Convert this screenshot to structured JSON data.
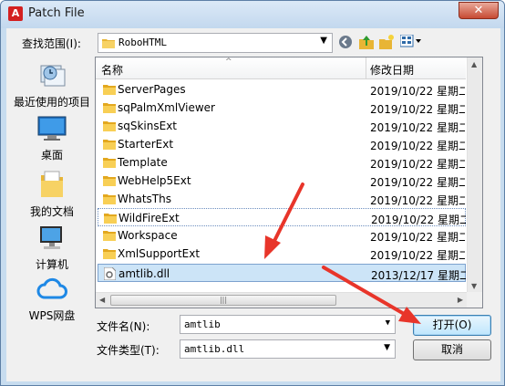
{
  "window": {
    "title": "Patch File",
    "app_icon_letter": "A",
    "close_symbol": "✕"
  },
  "lookin": {
    "label": "查找范围(I):",
    "value": "RoboHTML"
  },
  "toolbar": {
    "back_icon": "back-arrow-icon",
    "up_icon": "up-folder-icon",
    "newfolder_icon": "new-folder-icon",
    "views_icon": "views-menu-icon"
  },
  "places": [
    {
      "label": "最近使用的项目",
      "icon": "recent-items-icon"
    },
    {
      "label": "桌面",
      "icon": "desktop-icon"
    },
    {
      "label": "我的文档",
      "icon": "documents-icon"
    },
    {
      "label": "计算机",
      "icon": "computer-icon"
    },
    {
      "label": "WPS网盘",
      "icon": "cloud-icon"
    }
  ],
  "columns": {
    "name": "名称",
    "modified": "修改日期"
  },
  "files": [
    {
      "name": "ServerPages",
      "date": "2019/10/22 星期二 ...",
      "type": "folder"
    },
    {
      "name": "sqPalmXmlViewer",
      "date": "2019/10/22 星期二 ...",
      "type": "folder"
    },
    {
      "name": "sqSkinsExt",
      "date": "2019/10/22 星期二 ...",
      "type": "folder"
    },
    {
      "name": "StarterExt",
      "date": "2019/10/22 星期二 ...",
      "type": "folder"
    },
    {
      "name": "Template",
      "date": "2019/10/22 星期二 ...",
      "type": "folder"
    },
    {
      "name": "WebHelp5Ext",
      "date": "2019/10/22 星期二 ...",
      "type": "folder"
    },
    {
      "name": "WhatsThs",
      "date": "2019/10/22 星期二 ...",
      "type": "folder"
    },
    {
      "name": "WildFireExt",
      "date": "2019/10/22 星期二 ...",
      "type": "folder"
    },
    {
      "name": "Workspace",
      "date": "2019/10/22 星期二 ...",
      "type": "folder"
    },
    {
      "name": "XmlSupportExt",
      "date": "2019/10/22 星期二 ...",
      "type": "folder"
    },
    {
      "name": "amtlib.dll",
      "date": "2013/12/17 星期二 ...",
      "type": "file"
    }
  ],
  "filename": {
    "label": "文件名(N):",
    "value": "amtlib"
  },
  "filetype": {
    "label": "文件类型(T):",
    "value": "amtlib.dll"
  },
  "buttons": {
    "open": "打开(O)",
    "cancel": "取消"
  },
  "colors": {
    "title_bar": "#c3d8ee",
    "close": "#c74a33",
    "arrow": "#e8352a",
    "selection": "#cce4f7"
  }
}
